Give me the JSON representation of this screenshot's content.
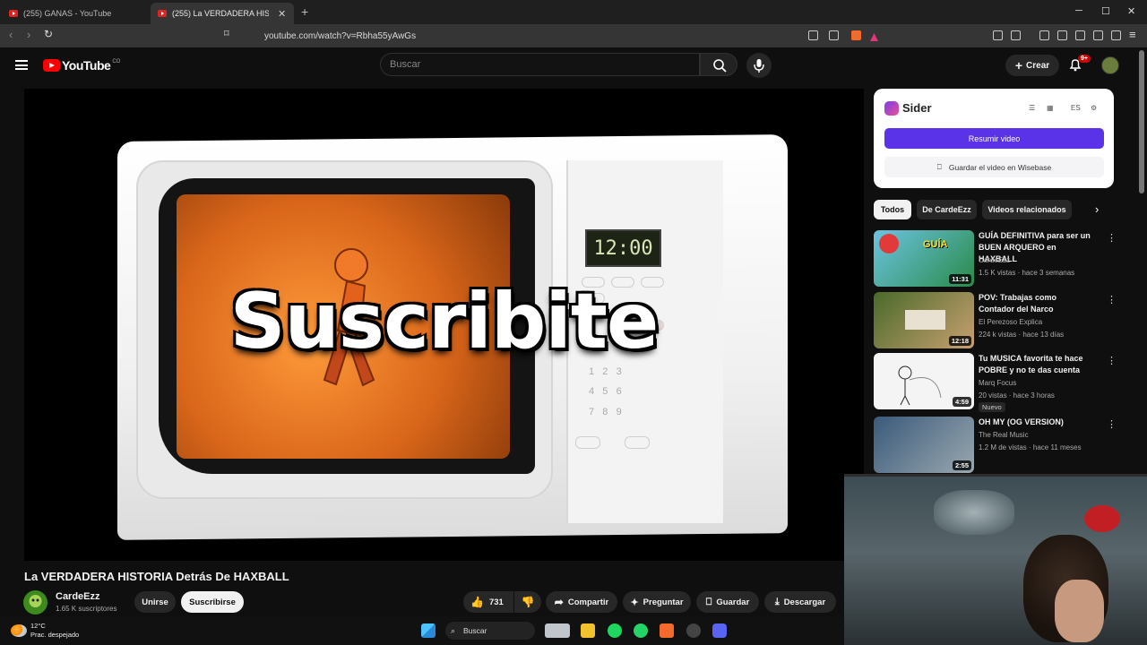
{
  "browser": {
    "tabs": [
      {
        "title": "(255) GANAS - YouTube",
        "active": false
      },
      {
        "title": "(255) La VERDADERA HISTORIA D",
        "active": true
      }
    ],
    "url": "youtube.com/watch?v=Rbha55yAwGs"
  },
  "youtube": {
    "logo_text": "YouTube",
    "logo_sup": "CO",
    "search_placeholder": "Buscar",
    "create_label": "Crear",
    "notif_count": "9+"
  },
  "video": {
    "overlay_text": "Suscribite",
    "clock": "12:00",
    "title": "La VERDADERA HISTORIA Detrás De HAXBALL",
    "channel": "CardeEzz",
    "subscribers": "1.65 K suscriptores",
    "join_label": "Unirse",
    "subscribe_label": "Suscribirse",
    "likes": "731",
    "share_label": "Compartir",
    "ask_label": "Preguntar",
    "save_label": "Guardar",
    "download_label": "Descargar"
  },
  "sider": {
    "name": "Sider",
    "lang": "ES",
    "summarize_label": "Resumir video",
    "wisebase_label": "Guardar el video en Wisebase"
  },
  "chips": [
    "Todos",
    "De CardeEzz",
    "Videos relacionados"
  ],
  "recommendations": [
    {
      "title": "GUÍA DEFINITIVA para ser un BUEN ARQUERO en HAXBALL",
      "channel": "CardeEzz",
      "meta": "1.5 K vistas · hace 3 semanas",
      "duration": "11:31",
      "badge": ""
    },
    {
      "title": "POV: Trabajas como Contador del Narco",
      "channel": "El Perezoso Explica",
      "meta": "224 k vistas · hace 13 días",
      "duration": "12:18",
      "badge": ""
    },
    {
      "title": "Tu MUSICA favorita te hace POBRE y no te das cuenta",
      "channel": "Marq Focus",
      "meta": "20 vistas · hace 3 horas",
      "duration": "4:59",
      "badge": "Nuevo"
    },
    {
      "title": "OH MY (OG VERSION)",
      "channel": "The Real Music",
      "meta": "1.2 M de vistas · hace 11 meses",
      "duration": "2:55",
      "badge": ""
    }
  ],
  "taskbar": {
    "temp": "12°C",
    "weather": "Prac. despejado",
    "search_label": "Buscar"
  }
}
